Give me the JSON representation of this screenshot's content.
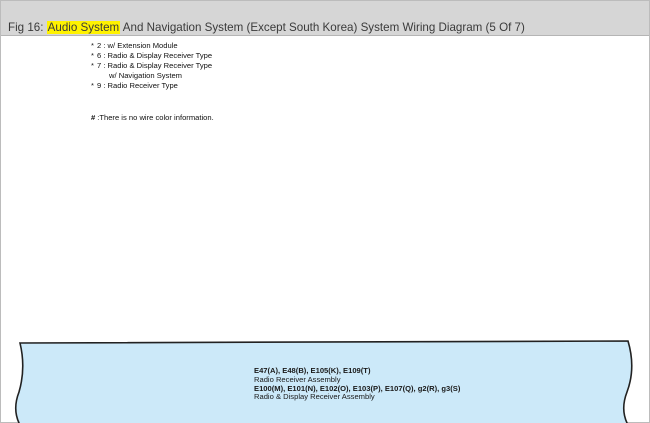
{
  "header": {
    "title_prefix": "Fig 16: ",
    "title_highlight": "Audio System",
    "title_rest": " And Navigation System (Except South Korea) System Wiring Diagram (5 Of 7)"
  },
  "notes": [
    {
      "star": "*",
      "text": "2 : w/ Extension Module"
    },
    {
      "star": "*",
      "text": "6 : Radio & Display Receiver Type"
    },
    {
      "star": "*",
      "text": "7 : Radio & Display Receiver Type",
      "continuation": "w/ Navigation System"
    },
    {
      "star": "*",
      "text": "9 : Radio Receiver Type"
    }
  ],
  "wire_note": {
    "mark": "#",
    "text": ":There is no wire color information."
  },
  "panel": {
    "fill_color": "#cce9f9",
    "connectors_1": "E47(A), E48(B), E105(K), E109(T)",
    "assembly_1": "Radio Receiver Assembly",
    "connectors_2": "E100(M), E101(N), E102(O), E103(P), E107(Q), g2(R), g3(S)",
    "assembly_2": "Radio & Display Receiver Assembly"
  }
}
